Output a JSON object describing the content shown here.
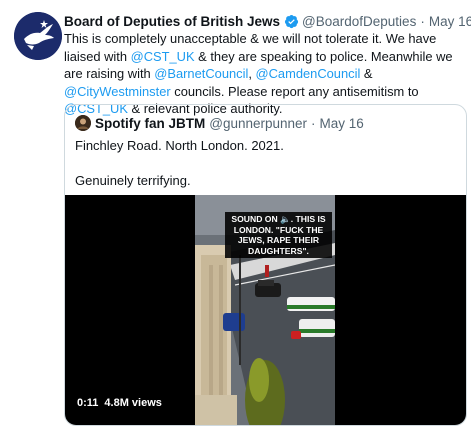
{
  "tweet": {
    "display_name": "Board of Deputies of British Jews",
    "handle": "@BoardofDeputies",
    "separator": "·",
    "date": "May 16",
    "verified_icon": "verified-badge-icon",
    "accent_color": "#1d9bf0",
    "text_parts": {
      "p1": "This is completely unacceptable & we will not tolerate it. We have liaised with ",
      "m1": "@CST_UK",
      "p2": " & they are speaking to police. Meanwhile we are raising with ",
      "m2": "@BarnetCouncil",
      "p3": ", ",
      "m3": "@CamdenCouncil",
      "p4": " & ",
      "m4": "@CityWestminster",
      "p5": " councils. Please report any antisemitism to ",
      "m5": "@CST_UK",
      "p6": " & relevant police authority."
    }
  },
  "quoted": {
    "display_name": "Spotify fan JBTM",
    "handle": "@gunnerpunner",
    "separator": "·",
    "date": "May 16",
    "text": "Finchley Road. North London. 2021.\n\nGenuinely terrifying.",
    "video": {
      "caption": "SOUND ON 🔈. THIS IS LONDON. \"FUCK THE JEWS, RAPE THEIR DAUGHTERS\".",
      "duration": "0:11",
      "views": "4.8M views"
    }
  }
}
